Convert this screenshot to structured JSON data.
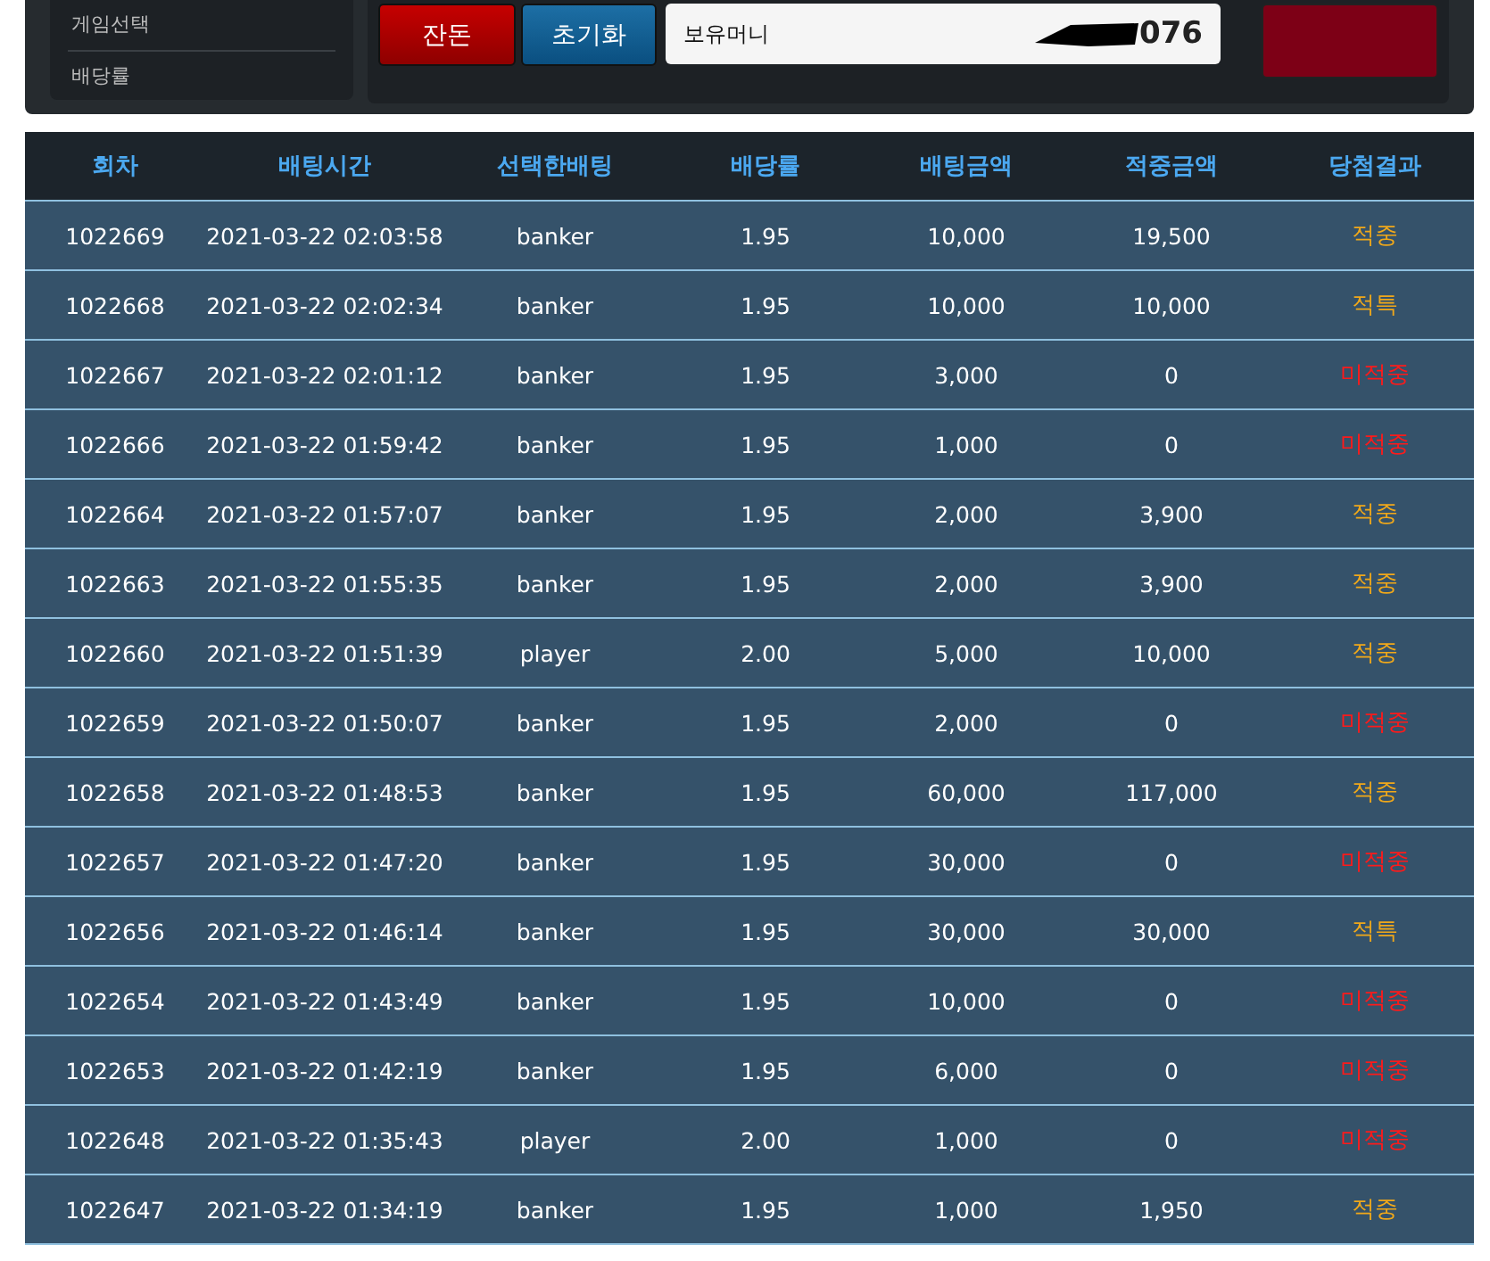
{
  "sidebar": {
    "items": [
      {
        "label": "게임선택"
      },
      {
        "label": "배당률"
      }
    ]
  },
  "buttons": [
    {
      "label": "잔돈",
      "kind": "red"
    },
    {
      "label": "초기화",
      "kind": "blue"
    }
  ],
  "balance": {
    "label": "보유머니",
    "value": "076"
  },
  "table": {
    "columns": [
      "회차",
      "배팅시간",
      "선택한배팅",
      "배당률",
      "배팅금액",
      "적중금액",
      "당첨결과"
    ],
    "rows": [
      {
        "cells": [
          "1022669",
          "2021-03-22 02:03:58",
          "banker",
          "1.95",
          "10,000",
          "19,500"
        ],
        "result": "적중",
        "kind": "hit"
      },
      {
        "cells": [
          "1022668",
          "2021-03-22 02:02:34",
          "banker",
          "1.95",
          "10,000",
          "10,000"
        ],
        "result": "적특",
        "kind": "hit"
      },
      {
        "cells": [
          "1022667",
          "2021-03-22 02:01:12",
          "banker",
          "1.95",
          "3,000",
          "0"
        ],
        "result": "미적중",
        "kind": "miss"
      },
      {
        "cells": [
          "1022666",
          "2021-03-22 01:59:42",
          "banker",
          "1.95",
          "1,000",
          "0"
        ],
        "result": "미적중",
        "kind": "miss"
      },
      {
        "cells": [
          "1022664",
          "2021-03-22 01:57:07",
          "banker",
          "1.95",
          "2,000",
          "3,900"
        ],
        "result": "적중",
        "kind": "hit"
      },
      {
        "cells": [
          "1022663",
          "2021-03-22 01:55:35",
          "banker",
          "1.95",
          "2,000",
          "3,900"
        ],
        "result": "적중",
        "kind": "hit"
      },
      {
        "cells": [
          "1022660",
          "2021-03-22 01:51:39",
          "player",
          "2.00",
          "5,000",
          "10,000"
        ],
        "result": "적중",
        "kind": "hit"
      },
      {
        "cells": [
          "1022659",
          "2021-03-22 01:50:07",
          "banker",
          "1.95",
          "2,000",
          "0"
        ],
        "result": "미적중",
        "kind": "miss"
      },
      {
        "cells": [
          "1022658",
          "2021-03-22 01:48:53",
          "banker",
          "1.95",
          "60,000",
          "117,000"
        ],
        "result": "적중",
        "kind": "hit"
      },
      {
        "cells": [
          "1022657",
          "2021-03-22 01:47:20",
          "banker",
          "1.95",
          "30,000",
          "0"
        ],
        "result": "미적중",
        "kind": "miss"
      },
      {
        "cells": [
          "1022656",
          "2021-03-22 01:46:14",
          "banker",
          "1.95",
          "30,000",
          "30,000"
        ],
        "result": "적특",
        "kind": "hit"
      },
      {
        "cells": [
          "1022654",
          "2021-03-22 01:43:49",
          "banker",
          "1.95",
          "10,000",
          "0"
        ],
        "result": "미적중",
        "kind": "miss"
      },
      {
        "cells": [
          "1022653",
          "2021-03-22 01:42:19",
          "banker",
          "1.95",
          "6,000",
          "0"
        ],
        "result": "미적중",
        "kind": "miss"
      },
      {
        "cells": [
          "1022648",
          "2021-03-22 01:35:43",
          "player",
          "2.00",
          "1,000",
          "0"
        ],
        "result": "미적중",
        "kind": "miss"
      },
      {
        "cells": [
          "1022647",
          "2021-03-22 01:34:19",
          "banker",
          "1.95",
          "1,000",
          "1,950"
        ],
        "result": "적중",
        "kind": "hit"
      }
    ]
  }
}
